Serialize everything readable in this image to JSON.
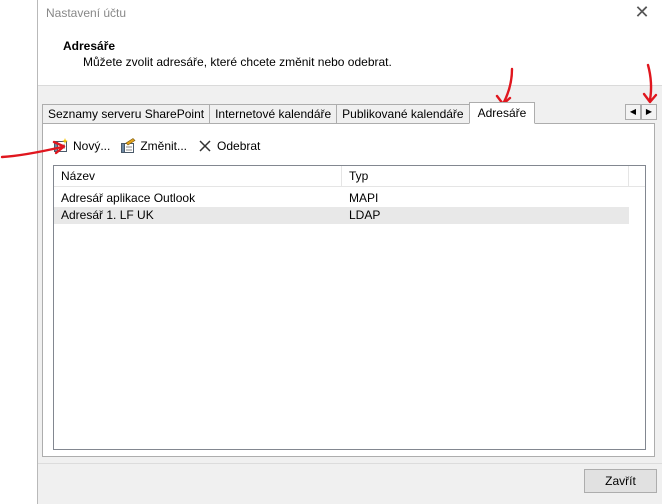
{
  "window": {
    "title": "Nastavení účtu",
    "close_glyph": "✕"
  },
  "header": {
    "title": "Adresáře",
    "subtitle": "Můžete zvolit adresáře, které chcete změnit nebo odebrat."
  },
  "tabs": [
    {
      "label": "Seznamy serveru SharePoint",
      "active": false
    },
    {
      "label": "Internetové kalendáře",
      "active": false
    },
    {
      "label": "Publikované kalendáře",
      "active": false
    },
    {
      "label": "Adresáře",
      "active": true
    }
  ],
  "tab_scroll": {
    "left_glyph": "◀",
    "right_glyph": "▶"
  },
  "toolbar": {
    "new_label": "Nový...",
    "new_icon": "new-address-book-icon",
    "change_label": "Změnit...",
    "change_icon": "edit-address-book-icon",
    "remove_label": "Odebrat",
    "remove_icon": "remove-x-icon"
  },
  "list": {
    "columns": [
      "Název",
      "Typ"
    ],
    "rows": [
      {
        "name": "Adresář aplikace Outlook",
        "type": "MAPI",
        "selected": false
      },
      {
        "name": "Adresář 1. LF UK",
        "type": "LDAP",
        "selected": true
      }
    ]
  },
  "footer": {
    "close_label": "Zavřít"
  },
  "colors": {
    "annotation_red": "#e0161e",
    "dialog_bg": "#f0f0f0",
    "selected_row": "#e8e8e8"
  }
}
